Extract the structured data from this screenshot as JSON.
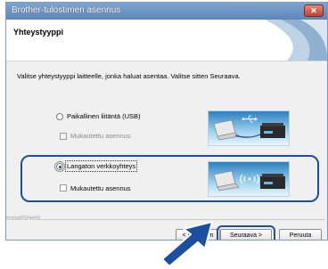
{
  "window": {
    "title": "Brother-tulostimen asennus",
    "close_glyph": "✕"
  },
  "header": {
    "title": "Yhteystyyppi"
  },
  "instruction": "Valitse yhteystyyppi laitteelle, jonka haluat asentaa. Valitse sitten Seuraava.",
  "options": [
    {
      "label": "Paikallinen liitäntä (USB)",
      "selected": false,
      "custom_install_label": "Mukautettu asennus",
      "custom_install_checked": false,
      "custom_install_enabled": false,
      "illustration": "usb-connection-illustration"
    },
    {
      "label": "Langaton verkkoyhteys",
      "selected": true,
      "custom_install_label": "Mukautettu asennus",
      "custom_install_checked": false,
      "custom_install_enabled": true,
      "illustration": "wireless-connection-illustration"
    }
  ],
  "footer": {
    "brand": "InstallShield",
    "back_label": "< Edellinen",
    "next_label": "Seuraava >",
    "cancel_label": "Peruuta"
  },
  "colors": {
    "titlebar": "#6d93c3",
    "highlight": "#1c4fa0",
    "panel": "#f0f0f0"
  },
  "icons": [
    "close-icon",
    "usb-icon",
    "wifi-icon",
    "laptop-icon",
    "printer-icon",
    "pointer-arrow-icon"
  ]
}
